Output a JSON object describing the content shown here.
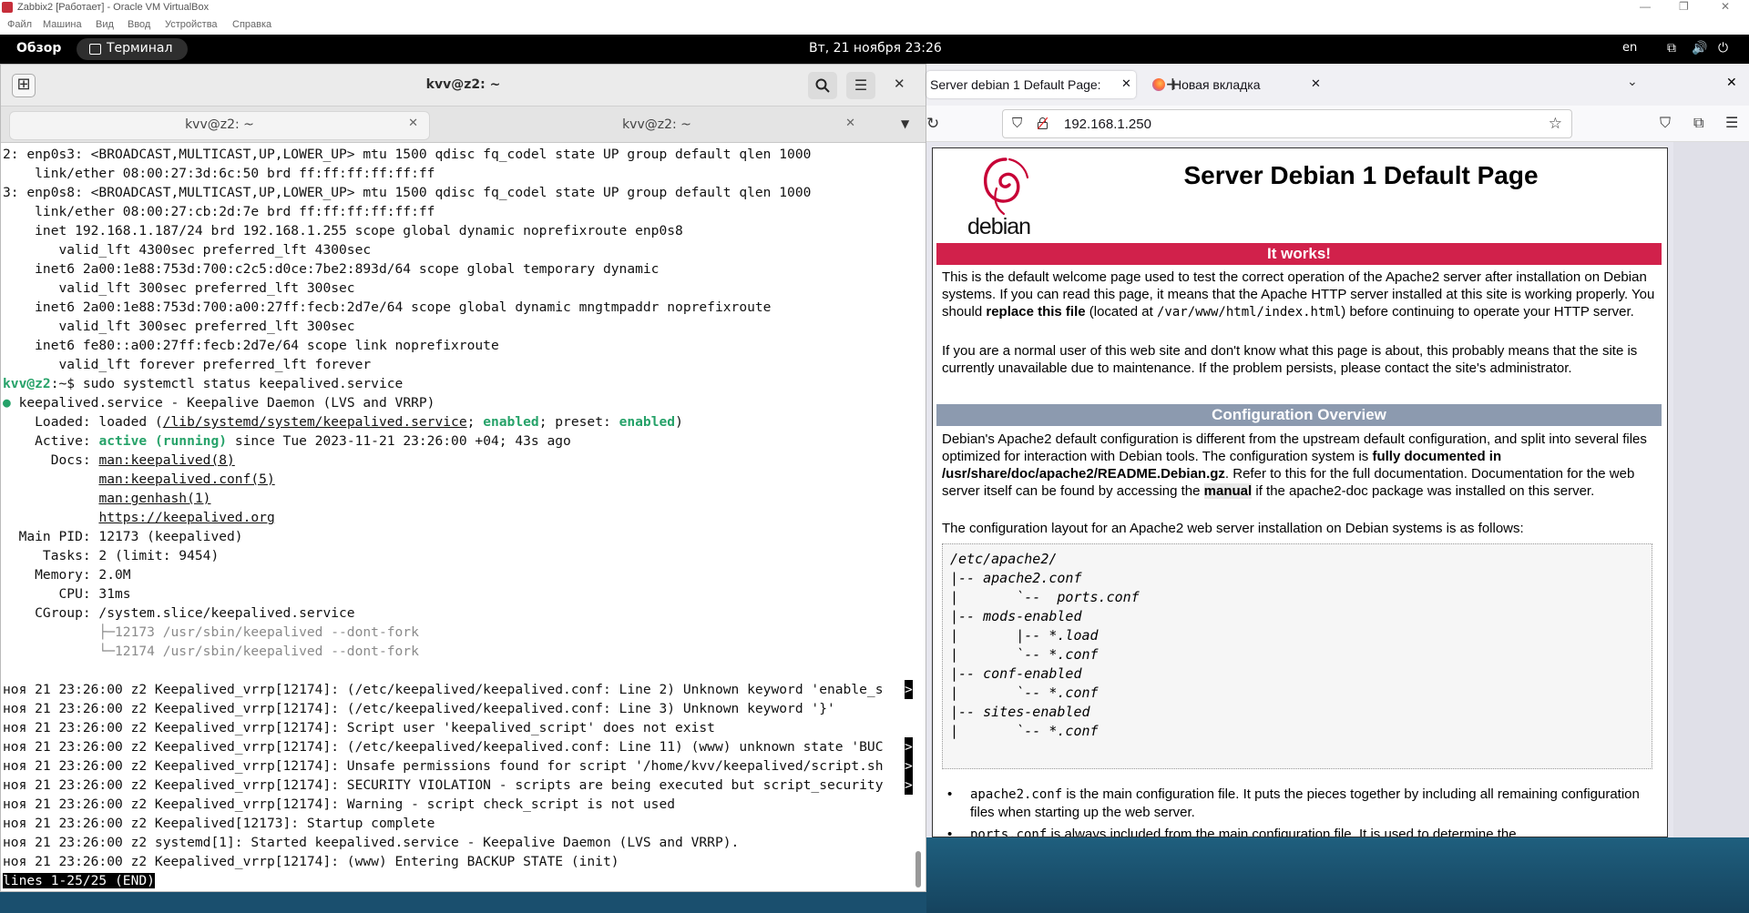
{
  "vbox": {
    "title": "Zabbix2 [Работает] - Oracle VM VirtualBox",
    "menu": [
      "Файл",
      "Машина",
      "Вид",
      "Ввод",
      "Устройства",
      "Справка"
    ]
  },
  "gnome": {
    "overview": "Обзор",
    "app_name": "Терминал",
    "clock": "Вт, 21 ноября  23:26",
    "lang": "en"
  },
  "terminal": {
    "title": "kvv@z2: ~",
    "tabs": [
      {
        "label": "kvv@z2: ~",
        "active": true
      },
      {
        "label": "kvv@z2: ~",
        "active": false
      }
    ],
    "prompt_user": "kvv@z2",
    "prompt_rest": ":~$ sudo systemctl status keepalived.service",
    "pre_lines": [
      "2: enp0s3: <BROADCAST,MULTICAST,UP,LOWER_UP> mtu 1500 qdisc fq_codel state UP group default qlen 1000",
      "    link/ether 08:00:27:3d:6c:50 brd ff:ff:ff:ff:ff:ff",
      "3: enp0s8: <BROADCAST,MULTICAST,UP,LOWER_UP> mtu 1500 qdisc fq_codel state UP group default qlen 1000",
      "    link/ether 08:00:27:cb:2d:7e brd ff:ff:ff:ff:ff:ff",
      "    inet 192.168.1.187/24 brd 192.168.1.255 scope global dynamic noprefixroute enp0s8",
      "       valid_lft 4300sec preferred_lft 4300sec",
      "    inet6 2a00:1e88:753d:700:c2c5:d0ce:7be2:893d/64 scope global temporary dynamic",
      "       valid_lft 300sec preferred_lft 300sec",
      "    inet6 2a00:1e88:753d:700:a00:27ff:fecb:2d7e/64 scope global dynamic mngtmpaddr noprefixroute",
      "       valid_lft 300sec preferred_lft 300sec",
      "    inet6 fe80::a00:27ff:fecb:2d7e/64 scope link noprefixroute",
      "       valid_lft forever preferred_lft forever"
    ],
    "svc_dot": "●",
    "svc_head": " keepalived.service - Keepalive Daemon (LVS and VRRP)",
    "loaded_a": "    Loaded: loaded (",
    "loaded_path": "/lib/systemd/system/keepalived.service",
    "loaded_b": "; ",
    "loaded_enabled": "enabled",
    "loaded_c": "; preset: ",
    "loaded_preset": "enabled",
    "loaded_d": ")",
    "active_a": "    Active: ",
    "active_state": "active (running)",
    "active_b": " since Tue 2023-11-21 23:26:00 +04; 43s ago",
    "docs_a": "      Docs: ",
    "docs": [
      "man:keepalived(8)",
      "man:keepalived.conf(5)",
      "man:genhash(1)",
      "https://keepalived.org"
    ],
    "docs_indent": "            ",
    "post_lines": [
      "  Main PID: 12173 (keepalived)",
      "     Tasks: 2 (limit: 9454)",
      "    Memory: 2.0M",
      "       CPU: 31ms",
      "    CGroup: /system.slice/keepalived.service"
    ],
    "cgroup_lines": [
      "            ├─12173 /usr/sbin/keepalived --dont-fork",
      "            └─12174 /usr/sbin/keepalived --dont-fork"
    ],
    "log_lines": [
      {
        "text": "ноя 21 23:26:00 z2 Keepalived_vrrp[12174]: (/etc/keepalived/keepalived.conf: Line 2) Unknown keyword 'enable_s",
        "trunc": true
      },
      {
        "text": "ноя 21 23:26:00 z2 Keepalived_vrrp[12174]: (/etc/keepalived/keepalived.conf: Line 3) Unknown keyword '}'",
        "trunc": false
      },
      {
        "text": "ноя 21 23:26:00 z2 Keepalived_vrrp[12174]: Script user 'keepalived_script' does not exist",
        "trunc": false
      },
      {
        "text": "ноя 21 23:26:00 z2 Keepalived_vrrp[12174]: (/etc/keepalived/keepalived.conf: Line 11) (www) unknown state 'BUC",
        "trunc": true
      },
      {
        "text": "ноя 21 23:26:00 z2 Keepalived_vrrp[12174]: Unsafe permissions found for script '/home/kvv/keepalived/script.sh",
        "trunc": true
      },
      {
        "text": "ноя 21 23:26:00 z2 Keepalived_vrrp[12174]: SECURITY VIOLATION - scripts are being executed but script_security",
        "trunc": true
      },
      {
        "text": "ноя 21 23:26:00 z2 Keepalived_vrrp[12174]: Warning - script check_script is not used",
        "trunc": false
      },
      {
        "text": "ноя 21 23:26:00 z2 Keepalived[12173]: Startup complete",
        "trunc": false
      },
      {
        "text": "ноя 21 23:26:00 z2 systemd[1]: Started keepalived.service - Keepalive Daemon (LVS and VRRP).",
        "trunc": false
      },
      {
        "text": "ноя 21 23:26:00 z2 Keepalived_vrrp[12174]: (www) Entering BACKUP STATE (init)",
        "trunc": false
      }
    ],
    "trunc_mark": ">",
    "pager_status": "lines 1-25/25 (END)"
  },
  "firefox": {
    "tabs": [
      {
        "label": "Server debian 1 Default Page:",
        "active": true
      },
      {
        "label": "Новая вкладка",
        "active": false
      }
    ],
    "url": "192.168.1.250"
  },
  "apache": {
    "logo_text": "debian",
    "title": "Server Debian 1 Default Page",
    "banner_works": "It works!",
    "p1_a": "This is the default welcome page used to test the correct operation of the Apache2 server after installation on Debian systems. If you can read this page, it means that the Apache HTTP server installed at this site is working properly. You should ",
    "p1_bold": "replace this file",
    "p1_b": " (located at ",
    "p1_code": "/var/www/html/index.html",
    "p1_c": ") before continuing to operate your HTTP server.",
    "p2": "If you are a normal user of this web site and don't know what this page is about, this probably means that the site is currently unavailable due to maintenance. If the problem persists, please contact the site's administrator.",
    "banner_config": "Configuration Overview",
    "p3_a": "Debian's Apache2 default configuration is different from the upstream default configuration, and split into several files optimized for interaction with Debian tools. The configuration system is ",
    "p3_bold": "fully documented in /usr/share/doc/apache2/README.Debian.gz",
    "p3_b": ". Refer to this for the full documentation. Documentation for the web server itself can be found by accessing the ",
    "p3_manual": "manual",
    "p3_c": " if the apache2-doc package was installed on this server.",
    "p4": "The configuration layout for an Apache2 web server installation on Debian systems is as follows:",
    "pre": "/etc/apache2/\n|-- apache2.conf\n|       `--  ports.conf\n|-- mods-enabled\n|       |-- *.load\n|       `-- *.conf\n|-- conf-enabled\n|       `-- *.conf\n|-- sites-enabled\n|       `-- *.conf\n",
    "li1_code": "apache2.conf",
    "li1_text": " is the main configuration file. It puts the pieces together by including all remaining configuration files when starting up the web server.",
    "li2_code": "ports.conf",
    "li2_text": " is always included from the main configuration file. It is used to determine the",
    "bullet": "•"
  }
}
